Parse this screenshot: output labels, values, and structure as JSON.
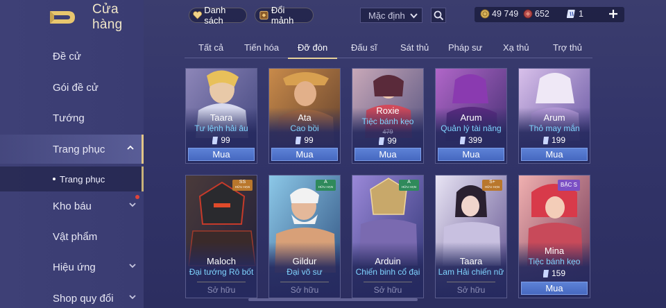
{
  "brand": {
    "title": "Cửa hàng"
  },
  "sidebar": {
    "items": [
      {
        "label": "Đề cử"
      },
      {
        "label": "Gói đề cử"
      },
      {
        "label": "Tướng"
      },
      {
        "label": "Trang phục"
      },
      {
        "label": "Kho báu"
      },
      {
        "label": "Vật phẩm"
      },
      {
        "label": "Hiệu ứng"
      },
      {
        "label": "Shop quy đổi"
      }
    ],
    "sub_item": {
      "label": "Trang phục"
    }
  },
  "topbar": {
    "wishlist_label": "Danh sách",
    "exchange_label": "Đổi mảnh",
    "sort": {
      "value": "Mặc định"
    },
    "currencies": {
      "gold": "49 749",
      "gems": "652",
      "vouchers": "1"
    }
  },
  "tabs": [
    {
      "label": "Tất cả"
    },
    {
      "label": "Tiến hóa"
    },
    {
      "label": "Đỡ đòn"
    },
    {
      "label": "Đấu sĩ"
    },
    {
      "label": "Sát thủ"
    },
    {
      "label": "Pháp sư"
    },
    {
      "label": "Xạ thủ"
    },
    {
      "label": "Trợ thủ"
    }
  ],
  "cards": [
    {
      "hero": "Taara",
      "skin": "Tư lệnh hải âu",
      "price": "99",
      "action": "Mua",
      "old_price": "",
      "badge": ""
    },
    {
      "hero": "Ata",
      "skin": "Cao bồi",
      "price": "99",
      "action": "Mua",
      "old_price": "",
      "badge": ""
    },
    {
      "hero": "Roxie",
      "skin": "Tiệc bánh kẹo",
      "price": "99",
      "action": "Mua",
      "old_price": "479",
      "badge": ""
    },
    {
      "hero": "Arum",
      "skin": "Quản lý tài năng",
      "price": "399",
      "action": "Mua",
      "old_price": "",
      "badge": ""
    },
    {
      "hero": "Arum",
      "skin": "Thỏ may mắn",
      "price": "199",
      "action": "Mua",
      "old_price": "",
      "badge": ""
    },
    {
      "hero": "Maloch",
      "skin": "Đại tướng Rô bốt",
      "price": "",
      "action": "Sở hữu",
      "old_price": "",
      "badge": "SS",
      "badge_sub": "HỮU HẠN"
    },
    {
      "hero": "Gildur",
      "skin": "Đại võ sư",
      "price": "",
      "action": "Sở hữu",
      "old_price": "",
      "badge": "A",
      "badge_sub": "HỮU HẠN"
    },
    {
      "hero": "Arduin",
      "skin": "Chiến binh cổ đại",
      "price": "",
      "action": "Sở hữu",
      "old_price": "",
      "badge": "A",
      "badge_sub": "HỮU HẠN"
    },
    {
      "hero": "Taara",
      "skin": "Lam Hải chiến nữ",
      "price": "",
      "action": "Sở hữu",
      "old_price": "",
      "badge": "S+",
      "badge_sub": "HỮU HẠN"
    },
    {
      "hero": "Mina",
      "skin": "Tiệc bánh kẹo",
      "price": "159",
      "action": "Mua",
      "old_price": "",
      "badge": "BẬC S",
      "badge_sub": ""
    }
  ],
  "colors": {
    "accent_gold": "#e8d29a",
    "buy_blue": "#4f72ca",
    "skin_text": "#7fd4ff",
    "badge_ss": "#b9772c",
    "badge_a": "#2f8a5b",
    "badge_splus": "#b9772c",
    "badge_bac": "#7b4fc4"
  }
}
